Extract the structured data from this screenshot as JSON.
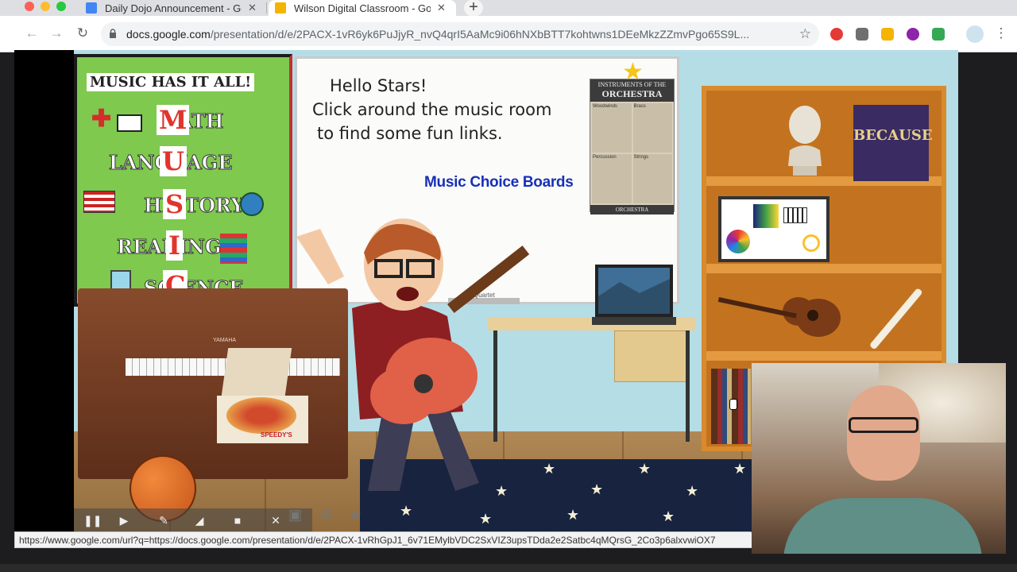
{
  "browser": {
    "tabs": [
      {
        "title": "Daily Dojo Announcement - Go",
        "icon": "docs-icon",
        "color": "#4285f4",
        "active": false
      },
      {
        "title": "Wilson Digital Classroom - Go",
        "icon": "slides-icon",
        "color": "#f4b400",
        "active": true
      }
    ],
    "url_prefix": "docs.google.com",
    "url_rest": "/presentation/d/e/2PACX-1vR6yk6PuJjyR_nvQ4qrI5AaMc9i06hNXbBTT7kohtwns1DEeMkzZZmvPgo65S9L..."
  },
  "slide": {
    "greeting_lines": [
      "Hello Stars!",
      "Click around the music room",
      "to find some fun links."
    ],
    "music_choice_boards": "Music Choice Boards",
    "bulletin": {
      "title": "MUSIC HAS IT ALL!",
      "words": [
        "MATH",
        "LANGUAGE",
        "HISTORY",
        "READING",
        "SCIENCE"
      ],
      "highlight_letters": [
        "M",
        "U",
        "S",
        "I",
        "C"
      ]
    },
    "poster": {
      "title": "ORCHESTRA",
      "heading": "INSTRUMENTS OF THE",
      "sections": [
        "Woodwinds",
        "Brass",
        "Percussion",
        "Strings"
      ],
      "footer": "ORCHESTRA"
    },
    "book_title": "BECAUSE",
    "whiteboard_brand": "Quartet",
    "piano_brand": "YAMAHA",
    "pizza_brand": "SPEEDY'S"
  },
  "status_url": "https://www.google.com/url?q=https://docs.google.com/presentation/d/e/2PACX-1vRhGpJ1_6v71EMylbVDC2SxVIZ3upsTDda2e2Satbc4qMQrsG_2Co3p6alxvwiOX7"
}
